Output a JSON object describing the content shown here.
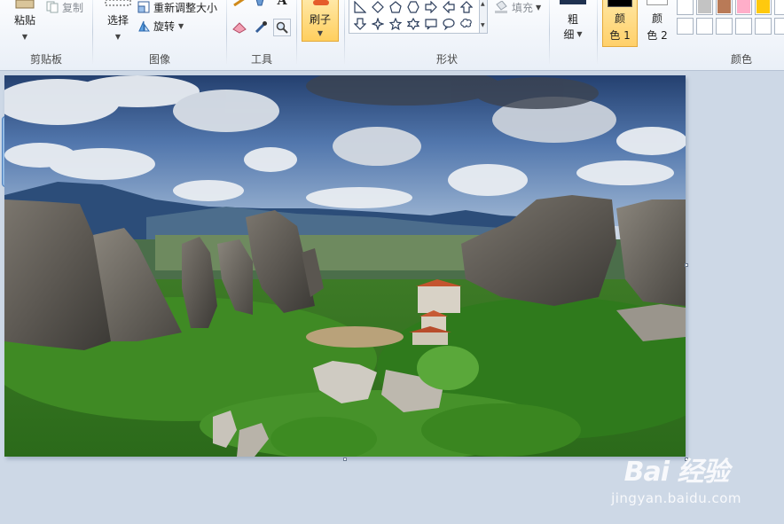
{
  "ribbon": {
    "clipboard": {
      "paste_label": "粘贴",
      "copy_label": "复制",
      "group_label": "剪贴板"
    },
    "image": {
      "select_label": "选择",
      "resize_label": "重新调整大小",
      "rotate_label": "旋转",
      "group_label": "图像"
    },
    "tools": {
      "group_label": "工具"
    },
    "brushes": {
      "label": "刷子"
    },
    "shapes": {
      "fill_label": "填充",
      "group_label": "形状"
    },
    "size": {
      "label_top": "粗",
      "label_bottom": "细"
    },
    "colors": {
      "color1_top": "颜",
      "color1_bottom": "色 1",
      "color2_top": "颜",
      "color2_bottom": "色 2",
      "group_label": "颜色",
      "color1_value": "#000000",
      "color2_value": "#ffffff",
      "palette_row1": [
        "#ffffff",
        "#c3c3c3",
        "#b97a57",
        "#ffaec9",
        "#ffc90e"
      ],
      "palette_row2": [
        "#ffffff",
        "#ffffff",
        "#ffffff",
        "#ffffff",
        "#ffffff"
      ]
    }
  },
  "canvas": {
    "image_subject": "Meteora rock pillars with monastery and green forest"
  },
  "watermark": {
    "logo": "Bai 经验",
    "url": "jingyan.baidu.com"
  }
}
